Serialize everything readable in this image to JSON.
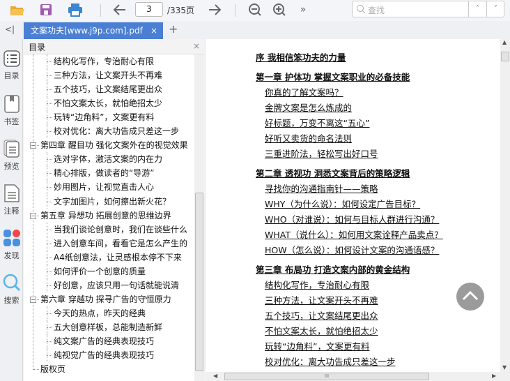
{
  "toolbar": {
    "page_current": "3",
    "page_total": "/335页",
    "more": "»",
    "search_placeholder": "查找",
    "up": "˄",
    "down": "˅"
  },
  "tabs": {
    "collapse": "<|",
    "doc_title": "文案功夫[www.j9p.com].pdf",
    "close": "×",
    "add": "+"
  },
  "rail": [
    {
      "label": "目录",
      "icon": "toc-icon"
    },
    {
      "label": "书签",
      "icon": "bookmark-icon"
    },
    {
      "label": "预览",
      "icon": "preview-icon"
    },
    {
      "label": "注释",
      "icon": "annotation-icon"
    },
    {
      "label": "发现",
      "icon": "discover-icon"
    },
    {
      "label": "搜索",
      "icon": "search-icon"
    }
  ],
  "toc": {
    "title": "目录",
    "close": "×",
    "items": [
      {
        "level": 2,
        "label": "结构化写作，专治耐心有限"
      },
      {
        "level": 2,
        "label": "三种方法，让文案开头不再难"
      },
      {
        "level": 2,
        "label": "五个技巧，让文案结尾更出众"
      },
      {
        "level": 2,
        "label": "不怕文案太长，就怕绝招太少"
      },
      {
        "level": 2,
        "label": "玩转“边角料”，文案更有料"
      },
      {
        "level": 2,
        "label": "校对优化：离大功告成只差这一步"
      },
      {
        "level": 1,
        "label": "第四章 醒目功 强化文案外在的视觉效果",
        "expander": "−"
      },
      {
        "level": 2,
        "label": "选对字体，激活文案的内在力"
      },
      {
        "level": 2,
        "label": "精心排版，做读者的“导游”"
      },
      {
        "level": 2,
        "label": "妙用图片，让视觉直击人心"
      },
      {
        "level": 2,
        "label": "文字加图片，如何擦出新火花？"
      },
      {
        "level": 1,
        "label": "第五章 异想功 拓展创意的思维边界",
        "expander": "−"
      },
      {
        "level": 2,
        "label": "当我们谈论创意时，我们在谈些什么"
      },
      {
        "level": 2,
        "label": "进入创意车间，看看它是怎么产生的"
      },
      {
        "level": 2,
        "label": "A4纸创意法，让灵感根本停不下来"
      },
      {
        "level": 2,
        "label": "如何评价一个创意的质量"
      },
      {
        "level": 2,
        "label": "好创意，应该只用一句话就能说清"
      },
      {
        "level": 1,
        "label": "第六章 穿越功 探寻广告的守恒原力",
        "expander": "−"
      },
      {
        "level": 2,
        "label": "今天的热点，昨天的经典"
      },
      {
        "level": 2,
        "label": "五大创意样板，总能制造新鲜"
      },
      {
        "level": 2,
        "label": "纯文案广告的经典表现技巧"
      },
      {
        "level": 2,
        "label": "纯视觉广告的经典表现技巧"
      },
      {
        "level": 1,
        "label": "版权页"
      }
    ]
  },
  "document": {
    "items": [
      {
        "type": "ch",
        "label": "序 我相信笨功夫的力量"
      },
      {
        "type": "ch",
        "label": "第一章 护体功 掌握文案职业的必备技能"
      },
      {
        "type": "sub",
        "label": "你真的了解文案吗？"
      },
      {
        "type": "sub",
        "label": "金牌文案是怎么炼成的"
      },
      {
        "type": "sub",
        "label": "好标题，万变不离这“五心”"
      },
      {
        "type": "sub",
        "label": "好听又卖货的命名法则"
      },
      {
        "type": "sub",
        "label": "三重进阶法，轻松写出好口号"
      },
      {
        "type": "ch",
        "label": "第二章 透视功 洞悉文案背后的策略逻辑"
      },
      {
        "type": "sub",
        "label": "寻找你的沟通指南针——策略"
      },
      {
        "type": "sub",
        "label": "WHY（为什么说）：如何设定广告目标？"
      },
      {
        "type": "sub",
        "label": "WHO（对谁说）：如何与目标人群进行沟通？"
      },
      {
        "type": "sub",
        "label": "WHAT（说什么）：如何用文案诠释产品卖点？"
      },
      {
        "type": "sub",
        "label": "HOW（怎么说）：如何设计文案的沟通语感？"
      },
      {
        "type": "ch",
        "label": "第三章 布局功 打造文案内部的黄金结构"
      },
      {
        "type": "sub",
        "label": "结构化写作，专治耐心有限"
      },
      {
        "type": "sub",
        "label": "三种方法，让文案开头不再难"
      },
      {
        "type": "sub",
        "label": "五个技巧，让文案结尾更出众"
      },
      {
        "type": "sub",
        "label": "不怕文案太长，就怕绝招太少"
      },
      {
        "type": "sub",
        "label": "玩转“边角料”，文案更有料"
      },
      {
        "type": "sub",
        "label": "校对优化：离大功告成只差这一步"
      }
    ]
  },
  "hscroll": {
    "grip": "III"
  }
}
